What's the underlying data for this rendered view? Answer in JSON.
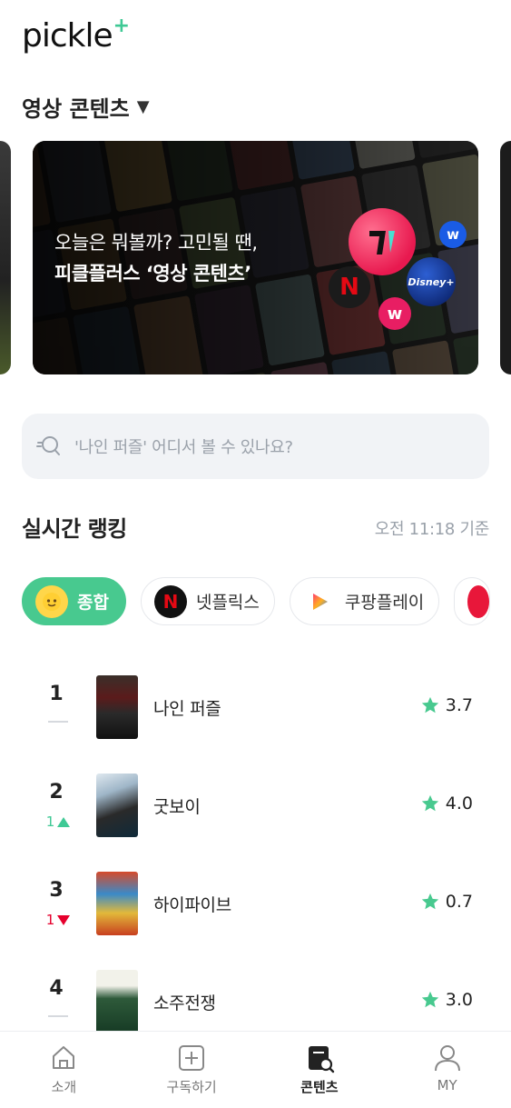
{
  "app": {
    "logo_text": "pickle",
    "logo_mark": "+"
  },
  "section": {
    "title": "영상 콘텐츠",
    "caret": "▼"
  },
  "banner": {
    "line1": "오늘은 뭐볼까? 고민될 땐,",
    "line2": "피클플러스 ‘영상 콘텐츠’",
    "service_icons": [
      "pickle-logo-icon",
      "netflix-icon",
      "disney-plus-icon",
      "wavve-icon",
      "watcha-icon"
    ]
  },
  "search": {
    "placeholder": "'나인 퍼즐' 어디서 볼 수 있나요?"
  },
  "ranking": {
    "title": "실시간 랭킹",
    "updated": "오전 11:18 기준",
    "filters": [
      {
        "label": "종합",
        "icon": "all-icon",
        "active": true
      },
      {
        "label": "넷플릭스",
        "icon": "netflix-icon",
        "active": false
      },
      {
        "label": "쿠팡플레이",
        "icon": "coupang-play-icon",
        "active": false
      }
    ],
    "items": [
      {
        "rank": "1",
        "change": "",
        "direction": "same",
        "title": "나인 퍼즐",
        "score": "3.7"
      },
      {
        "rank": "2",
        "change": "1",
        "direction": "up",
        "title": "굿보이",
        "score": "4.0"
      },
      {
        "rank": "3",
        "change": "1",
        "direction": "down",
        "title": "하이파이브",
        "score": "0.7"
      },
      {
        "rank": "4",
        "change": "",
        "direction": "same",
        "title": "소주전쟁",
        "score": "3.0"
      }
    ]
  },
  "nav": {
    "items": [
      {
        "label": "소개",
        "icon": "home-icon",
        "active": false
      },
      {
        "label": "구독하기",
        "icon": "plus-square-icon",
        "active": false
      },
      {
        "label": "콘텐츠",
        "icon": "content-search-icon",
        "active": true
      },
      {
        "label": "MY",
        "icon": "person-icon",
        "active": false
      }
    ]
  },
  "colors": {
    "accent": "#48c98f",
    "up": "#3fc995",
    "down": "#e6002d"
  }
}
